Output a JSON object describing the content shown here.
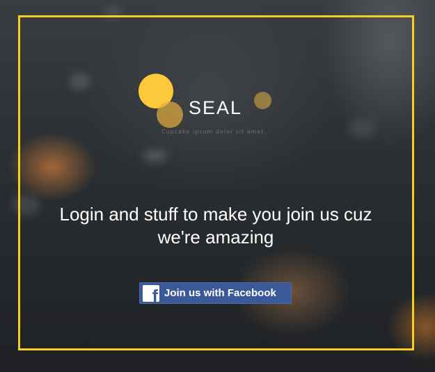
{
  "brand": {
    "name": "SEAL",
    "tagline": "Cupcake ipsum dolor sit amet.",
    "accent_color": "#f4cf26",
    "logo_circle_colors": [
      "#fdc93a",
      "#dfaa3c",
      "#c8a046"
    ]
  },
  "hero": {
    "headline": "Login and stuff to make you join us cuz we're amazing"
  },
  "facebook_button": {
    "label": "Join us with Facebook",
    "icon": "facebook-icon",
    "icon_glyph": "f",
    "color": "#3b5998"
  }
}
